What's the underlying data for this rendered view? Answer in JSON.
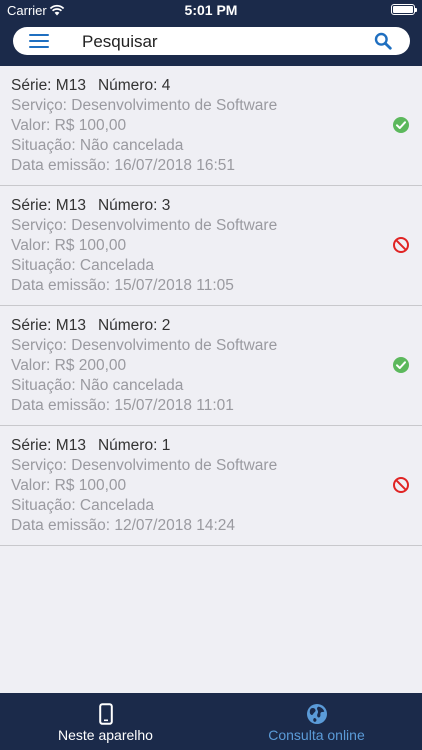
{
  "status_bar": {
    "carrier": "Carrier",
    "time": "5:01 PM"
  },
  "search": {
    "placeholder": "Pesquisar"
  },
  "invoices": [
    {
      "serie": "Série: M13",
      "numero": "Número: 4",
      "servico": "Serviço: Desenvolvimento de Software",
      "valor": "Valor: R$ 100,00",
      "situacao": "Situação: Não cancelada",
      "data": "Data emissão: 16/07/2018 16:51",
      "status": "active",
      "status_icon": "check-circle-icon"
    },
    {
      "serie": "Série: M13",
      "numero": "Número: 3",
      "servico": "Serviço: Desenvolvimento de Software",
      "valor": "Valor: R$ 100,00",
      "situacao": "Situação: Cancelada",
      "data": "Data emissão: 15/07/2018 11:05",
      "status": "cancelled",
      "status_icon": "cancelled-icon"
    },
    {
      "serie": "Série: M13",
      "numero": "Número: 2",
      "servico": "Serviço: Desenvolvimento de Software",
      "valor": "Valor: R$ 200,00",
      "situacao": "Situação: Não cancelada",
      "data": "Data emissão: 15/07/2018 11:01",
      "status": "active",
      "status_icon": "check-circle-icon"
    },
    {
      "serie": "Série: M13",
      "numero": "Número: 1",
      "servico": "Serviço: Desenvolvimento de Software",
      "valor": "Valor: R$ 100,00",
      "situacao": "Situação: Cancelada",
      "data": "Data emissão: 12/07/2018 14:24",
      "status": "cancelled",
      "status_icon": "cancelled-icon"
    }
  ],
  "tabs": [
    {
      "label": "Neste aparelho",
      "icon": "phone-icon",
      "active": true
    },
    {
      "label": "Consulta online",
      "icon": "globe-icon",
      "active": false
    }
  ],
  "colors": {
    "header": "#1b2a4a",
    "accent": "#1f6fc0",
    "active_status": "#5cb85c",
    "cancelled_status": "#e02424",
    "inactive_tab": "#5b9bd8"
  }
}
